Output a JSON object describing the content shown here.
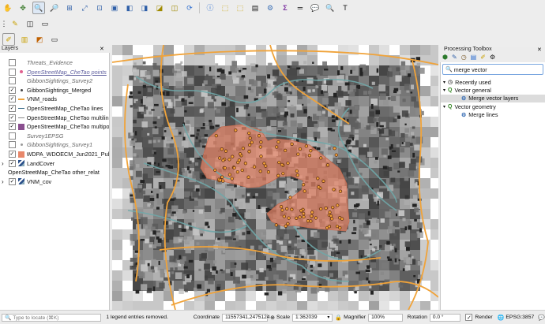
{
  "layers_panel": {
    "title": "Layers",
    "layers": [
      {
        "name": "Threats_Evidence",
        "checked": false,
        "style": "italic",
        "symbol": "none"
      },
      {
        "name": "OpenStreetMap_CheTao points",
        "checked": false,
        "style": "italic-underline",
        "symbol": "dot-pink"
      },
      {
        "name": "GibbonSightings_Survey2",
        "checked": false,
        "style": "italic",
        "symbol": "none"
      },
      {
        "name": "GibbonSightings_Merged",
        "checked": true,
        "style": "normal",
        "symbol": "dot-dark"
      },
      {
        "name": "VNM_roads",
        "checked": true,
        "style": "normal",
        "symbol": "line-orange"
      },
      {
        "name": "OpenStreetMap_CheTao lines",
        "checked": true,
        "style": "normal",
        "symbol": "line-teal"
      },
      {
        "name": "OpenStreetMap_CheTao multiline",
        "checked": true,
        "style": "normal",
        "symbol": "line-gray"
      },
      {
        "name": "OpenStreetMap_CheTao multipol",
        "checked": true,
        "style": "normal",
        "symbol": "fill-purple"
      },
      {
        "name": "Survey1EPSG",
        "checked": false,
        "style": "italic",
        "symbol": "none"
      },
      {
        "name": "GibbonSightings_Survey1",
        "checked": false,
        "style": "italic",
        "symbol": "dot-gray"
      },
      {
        "name": "WDPA_WDOECM_Jun2021_Publi",
        "checked": true,
        "style": "normal",
        "symbol": "fill-salmon"
      },
      {
        "name": "LandCover",
        "checked": true,
        "style": "normal",
        "symbol": "raster"
      },
      {
        "name": "OpenStreetMap_CheTao other_relat",
        "checked": false,
        "style": "normal",
        "symbol": "none-nochk"
      },
      {
        "name": "VNM_cov",
        "checked": true,
        "style": "normal",
        "symbol": "raster"
      }
    ]
  },
  "toolbox": {
    "title": "Processing Toolbox",
    "search_value": "merge vector",
    "items": [
      {
        "label": "Recently used",
        "level": 0,
        "icon": "clock-icon"
      },
      {
        "label": "Vector general",
        "level": 0,
        "icon": "qgis-icon"
      },
      {
        "label": "Merge vector layers",
        "level": 1,
        "icon": "gear-icon",
        "selected": true
      },
      {
        "label": "Vector geometry",
        "level": 0,
        "icon": "qgis-icon"
      },
      {
        "label": "Merge lines",
        "level": 1,
        "icon": "gear-icon"
      }
    ]
  },
  "status": {
    "locate_placeholder": "Type to locate (⌘K)",
    "message": "1 legend entries removed.",
    "coordinate_label": "Coordinate",
    "coordinate_value": "11557341,2475124",
    "scale_label": "Scale",
    "scale_value": "1:362039",
    "magnifier_label": "Magnifier",
    "magnifier_value": "100%",
    "rotation_label": "Rotation",
    "rotation_value": "0.0 °",
    "render_label": "Render",
    "crs": "EPSG:3857"
  },
  "colors": {
    "accent_selection": "#dcdcdc",
    "roads": "#f0a33a",
    "rivers": "#6fa7a8",
    "protected_area": "#e8876a",
    "sightings": "#b35a1f"
  }
}
